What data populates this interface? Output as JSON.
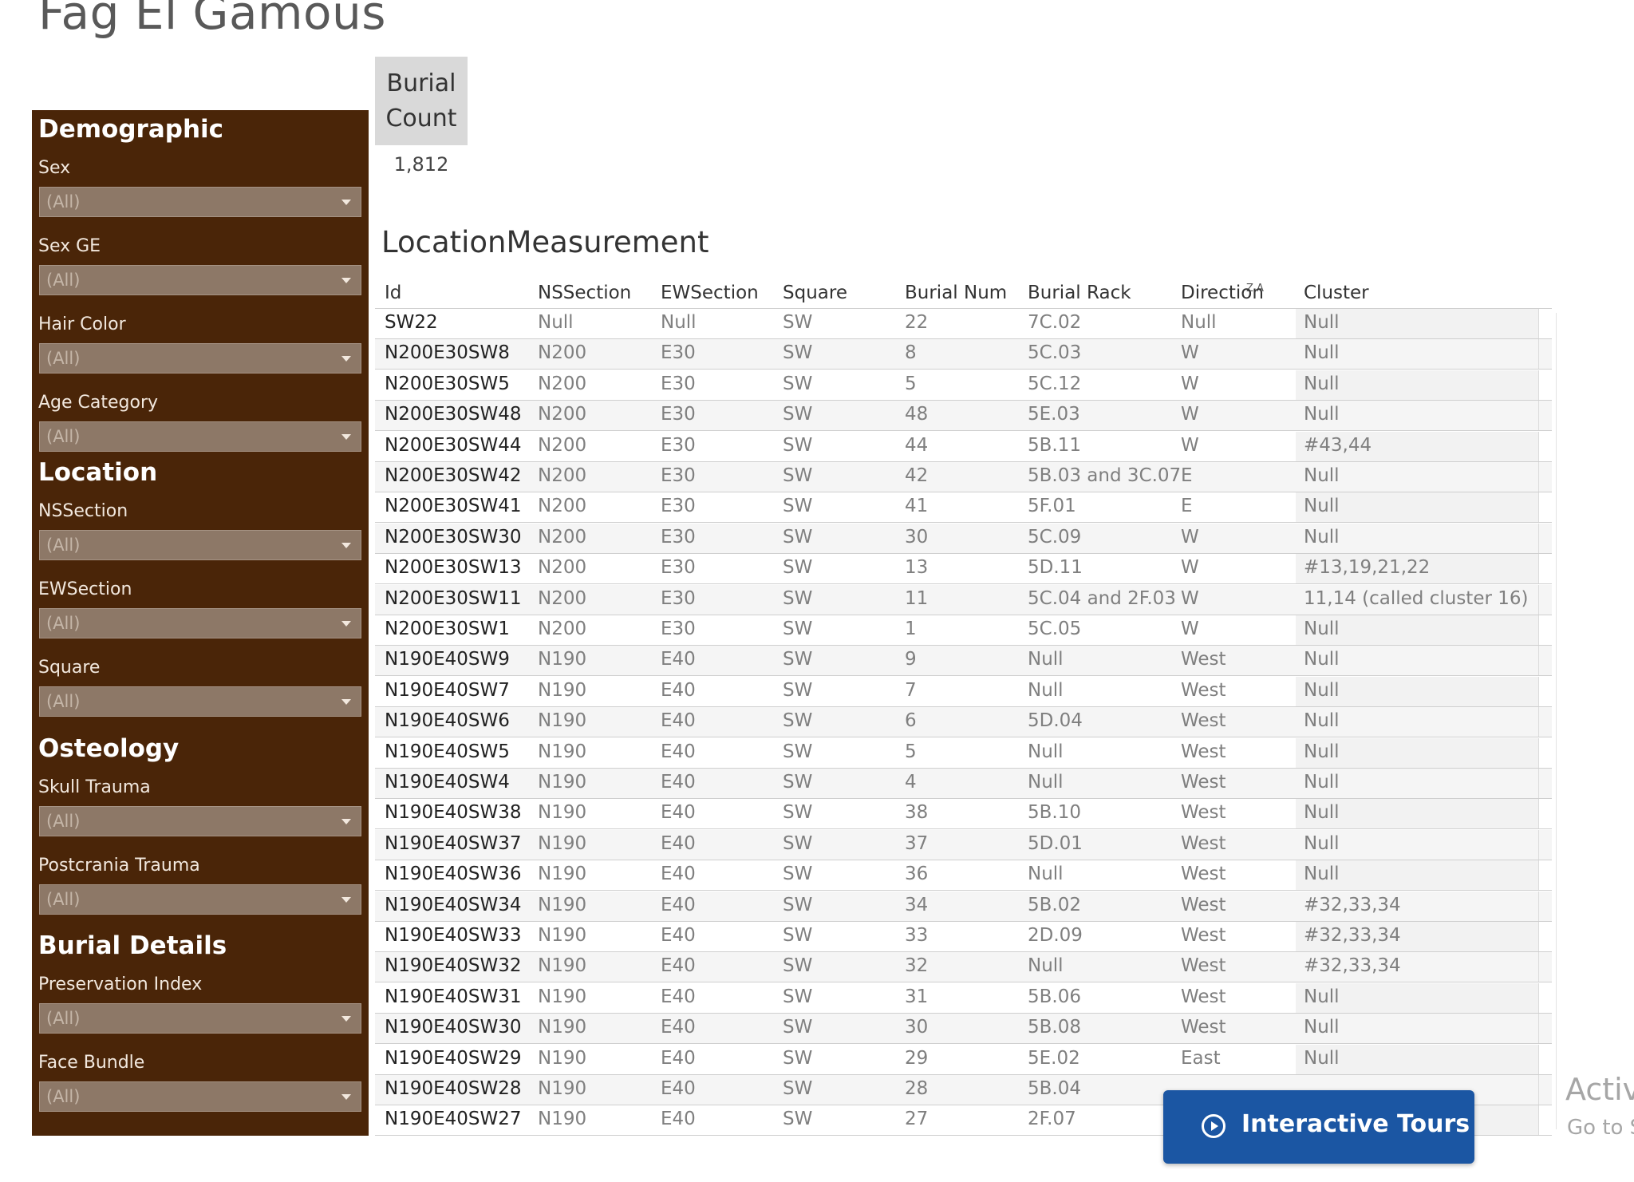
{
  "page_title": "Fag El Gamous",
  "filters": {
    "sections": [
      {
        "heading": "Demographic",
        "fields": [
          {
            "label": "Sex",
            "value": "(All)"
          },
          {
            "label": "Sex GE",
            "value": "(All)"
          },
          {
            "label": "Hair Color",
            "value": "(All)"
          },
          {
            "label": "Age Category",
            "value": "(All)"
          }
        ]
      },
      {
        "heading": "Location",
        "fields": [
          {
            "label": "NSSection",
            "value": "(All)"
          },
          {
            "label": "EWSection",
            "value": "(All)"
          },
          {
            "label": "Square",
            "value": "(All)"
          }
        ]
      },
      {
        "heading": "Osteology",
        "fields": [
          {
            "label": "Skull Trauma",
            "value": "(All)"
          },
          {
            "label": "Postcrania Trauma",
            "value": "(All)"
          }
        ]
      },
      {
        "heading": "Burial Details",
        "fields": [
          {
            "label": "Preservation Index",
            "value": "(All)"
          },
          {
            "label": "Face Bundle",
            "value": "(All)"
          }
        ]
      }
    ]
  },
  "kpi": {
    "label_line1": "Burial",
    "label_line2": "Count",
    "value": "1,812"
  },
  "table": {
    "title": "LocationMeasurement",
    "sort_icon": "Z A",
    "columns": [
      "Id",
      "NSSection",
      "EWSection",
      "Square",
      "Burial Num",
      "Burial Rack",
      "Direction",
      "Cluster"
    ],
    "rows": [
      [
        "SW22",
        "Null",
        "Null",
        "SW",
        "22",
        "7C.02",
        "Null",
        "Null"
      ],
      [
        "N200E30SW8",
        "N200",
        "E30",
        "SW",
        "8",
        "5C.03",
        "W",
        "Null"
      ],
      [
        "N200E30SW5",
        "N200",
        "E30",
        "SW",
        "5",
        "5C.12",
        "W",
        "Null"
      ],
      [
        "N200E30SW48",
        "N200",
        "E30",
        "SW",
        "48",
        "5E.03",
        "W",
        "Null"
      ],
      [
        "N200E30SW44",
        "N200",
        "E30",
        "SW",
        "44",
        "5B.11",
        "W",
        "#43,44"
      ],
      [
        "N200E30SW42",
        "N200",
        "E30",
        "SW",
        "42",
        "5B.03 and 3C.07",
        "E",
        "Null"
      ],
      [
        "N200E30SW41",
        "N200",
        "E30",
        "SW",
        "41",
        "5F.01",
        "E",
        "Null"
      ],
      [
        "N200E30SW30",
        "N200",
        "E30",
        "SW",
        "30",
        "5C.09",
        "W",
        "Null"
      ],
      [
        "N200E30SW13",
        "N200",
        "E30",
        "SW",
        "13",
        "5D.11",
        "W",
        "#13,19,21,22"
      ],
      [
        "N200E30SW11",
        "N200",
        "E30",
        "SW",
        "11",
        "5C.04 and 2F.03",
        "W",
        "11,14 (called cluster 16)"
      ],
      [
        "N200E30SW1",
        "N200",
        "E30",
        "SW",
        "1",
        "5C.05",
        "W",
        "Null"
      ],
      [
        "N190E40SW9",
        "N190",
        "E40",
        "SW",
        "9",
        "Null",
        "West",
        "Null"
      ],
      [
        "N190E40SW7",
        "N190",
        "E40",
        "SW",
        "7",
        "Null",
        "West",
        "Null"
      ],
      [
        "N190E40SW6",
        "N190",
        "E40",
        "SW",
        "6",
        "5D.04",
        "West",
        "Null"
      ],
      [
        "N190E40SW5",
        "N190",
        "E40",
        "SW",
        "5",
        "Null",
        "West",
        "Null"
      ],
      [
        "N190E40SW4",
        "N190",
        "E40",
        "SW",
        "4",
        "Null",
        "West",
        "Null"
      ],
      [
        "N190E40SW38",
        "N190",
        "E40",
        "SW",
        "38",
        "5B.10",
        "West",
        "Null"
      ],
      [
        "N190E40SW37",
        "N190",
        "E40",
        "SW",
        "37",
        "5D.01",
        "West",
        "Null"
      ],
      [
        "N190E40SW36",
        "N190",
        "E40",
        "SW",
        "36",
        "Null",
        "West",
        "Null"
      ],
      [
        "N190E40SW34",
        "N190",
        "E40",
        "SW",
        "34",
        "5B.02",
        "West",
        "#32,33,34"
      ],
      [
        "N190E40SW33",
        "N190",
        "E40",
        "SW",
        "33",
        "2D.09",
        "West",
        "#32,33,34"
      ],
      [
        "N190E40SW32",
        "N190",
        "E40",
        "SW",
        "32",
        "Null",
        "West",
        "#32,33,34"
      ],
      [
        "N190E40SW31",
        "N190",
        "E40",
        "SW",
        "31",
        "5B.06",
        "West",
        "Null"
      ],
      [
        "N190E40SW30",
        "N190",
        "E40",
        "SW",
        "30",
        "5B.08",
        "West",
        "Null"
      ],
      [
        "N190E40SW29",
        "N190",
        "E40",
        "SW",
        "29",
        "5E.02",
        "East",
        "Null"
      ],
      [
        "N190E40SW28",
        "N190",
        "E40",
        "SW",
        "28",
        "5B.04",
        "",
        ""
      ],
      [
        "N190E40SW27",
        "N190",
        "E40",
        "SW",
        "27",
        "2F.07",
        "",
        ""
      ]
    ]
  },
  "tours_button": {
    "label": "Interactive Tours"
  },
  "watermark": {
    "line1": "Activ",
    "line2": "Go to S"
  },
  "colors": {
    "sidebar": "#4a2508",
    "button": "#1b56a3"
  }
}
